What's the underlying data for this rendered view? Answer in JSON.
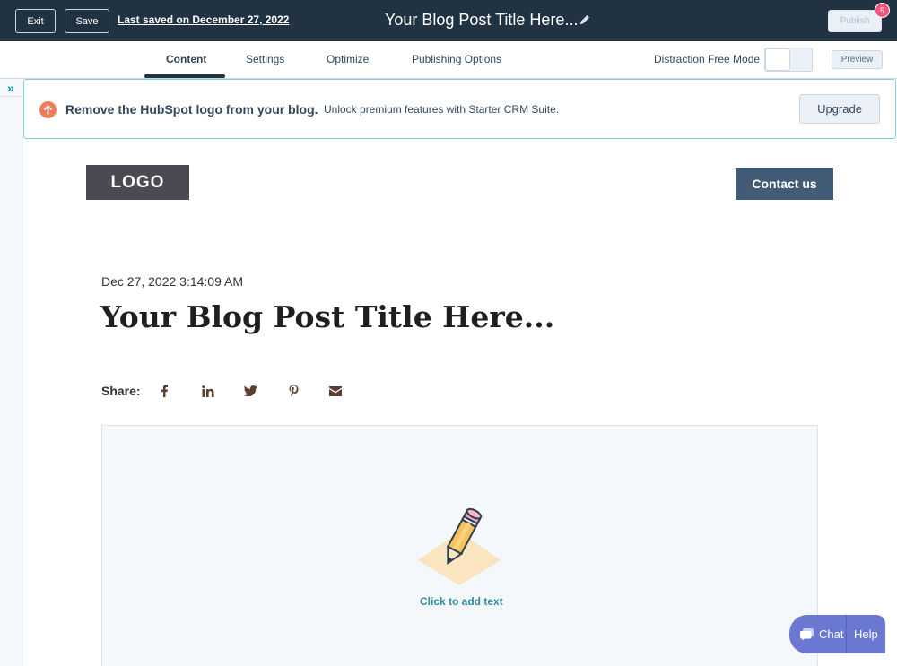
{
  "topbar": {
    "exit_label": "Exit",
    "save_label": "Save",
    "last_saved": "Last saved on December 27, 2022",
    "post_title": "Your Blog Post Title Here...",
    "publish_label": "Publish",
    "publish_badge_count": "5"
  },
  "tabs": [
    {
      "label": "Content",
      "active": true
    },
    {
      "label": "Settings",
      "active": false
    },
    {
      "label": "Optimize",
      "active": false
    },
    {
      "label": "Publishing Options",
      "active": false
    }
  ],
  "toolbar": {
    "distraction_free_label": "Distraction Free Mode",
    "distraction_free_on": false,
    "preview_label": "Preview"
  },
  "sidebar": {
    "expand_icon": "»"
  },
  "banner": {
    "title": "Remove the HubSpot logo from your blog.",
    "text": "Unlock premium features with Starter CRM Suite.",
    "upgrade_label": "Upgrade",
    "icon": "arrow-up-circle-icon"
  },
  "blog": {
    "logo_text": "LOGO",
    "contact_label": "Contact us",
    "date": "Dec 27, 2022 3:14:09 AM",
    "heading": "Your Blog Post Title Here...",
    "share_label": "Share:",
    "share_icons": [
      "facebook-icon",
      "linkedin-icon",
      "twitter-icon",
      "pinterest-icon",
      "email-icon"
    ],
    "add_text_label": "Click to add text"
  },
  "chat_widget": {
    "chat_label": "Chat",
    "help_label": "Help"
  },
  "colors": {
    "topbar_bg": "#213343",
    "accent_teal": "#0091ae",
    "banner_icon": "#f07c5e",
    "badge": "#f2547d",
    "contact_bg": "#425b76",
    "chat_bg": "#6a78d1"
  }
}
